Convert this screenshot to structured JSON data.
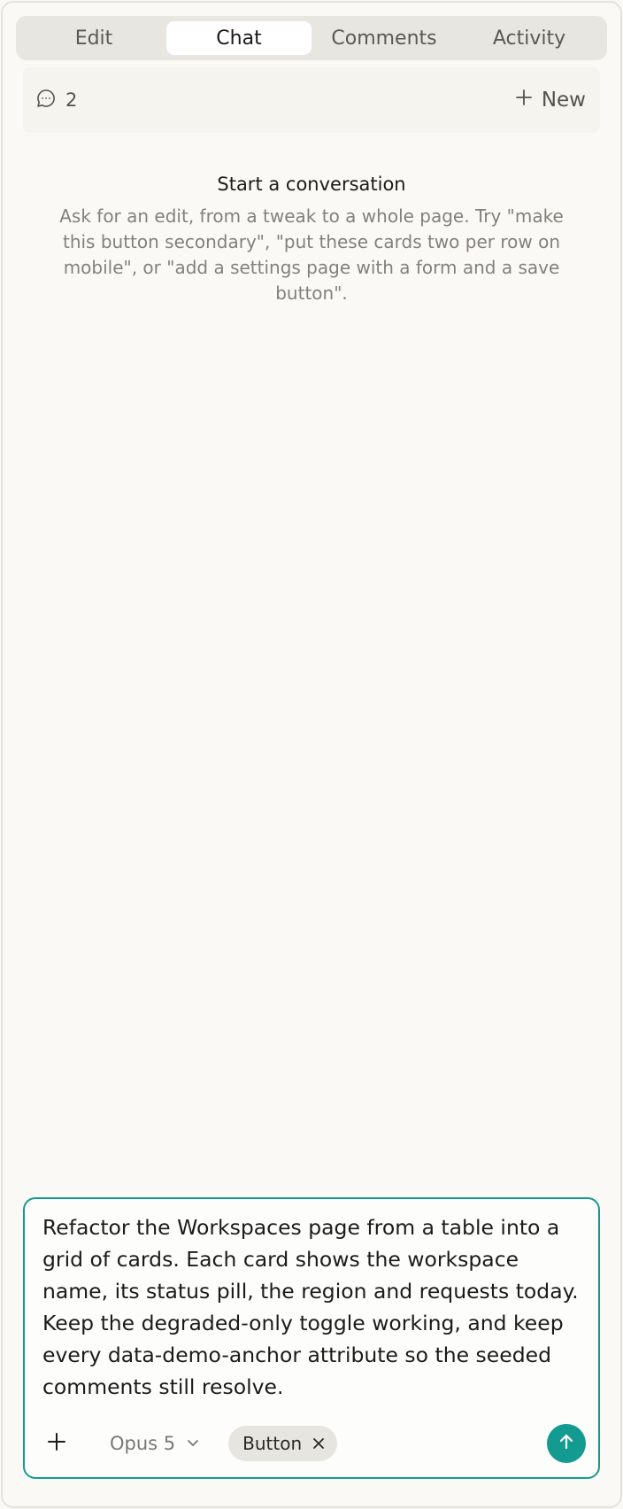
{
  "tabs": [
    {
      "label": "Edit"
    },
    {
      "label": "Chat"
    },
    {
      "label": "Comments"
    },
    {
      "label": "Activity"
    }
  ],
  "thread_bar": {
    "count": "2",
    "new_label": "New",
    "icons": {
      "count": "chat-bubble-icon",
      "new": "plus-icon"
    }
  },
  "empty_state": {
    "title": "Start a conversation",
    "text": "Ask for an edit, from a tweak to a whole page. Try \"make this button secondary\", \"put these cards two per row on mobile\", or \"add a settings page with a form and a save button\"."
  },
  "composer": {
    "value": "Refactor the Workspaces page from a table into a grid of cards. Each card shows the workspace name, its status pill, the region and requests today. Keep the degraded-only toggle working, and keep every data-demo-anchor attribute so the seeded comments still resolve.",
    "model": "Opus 5",
    "chip": "Button"
  },
  "colors": {
    "accent": "#149b91",
    "background": "#faf9f5",
    "tabs_bg": "#e8e6e0"
  }
}
